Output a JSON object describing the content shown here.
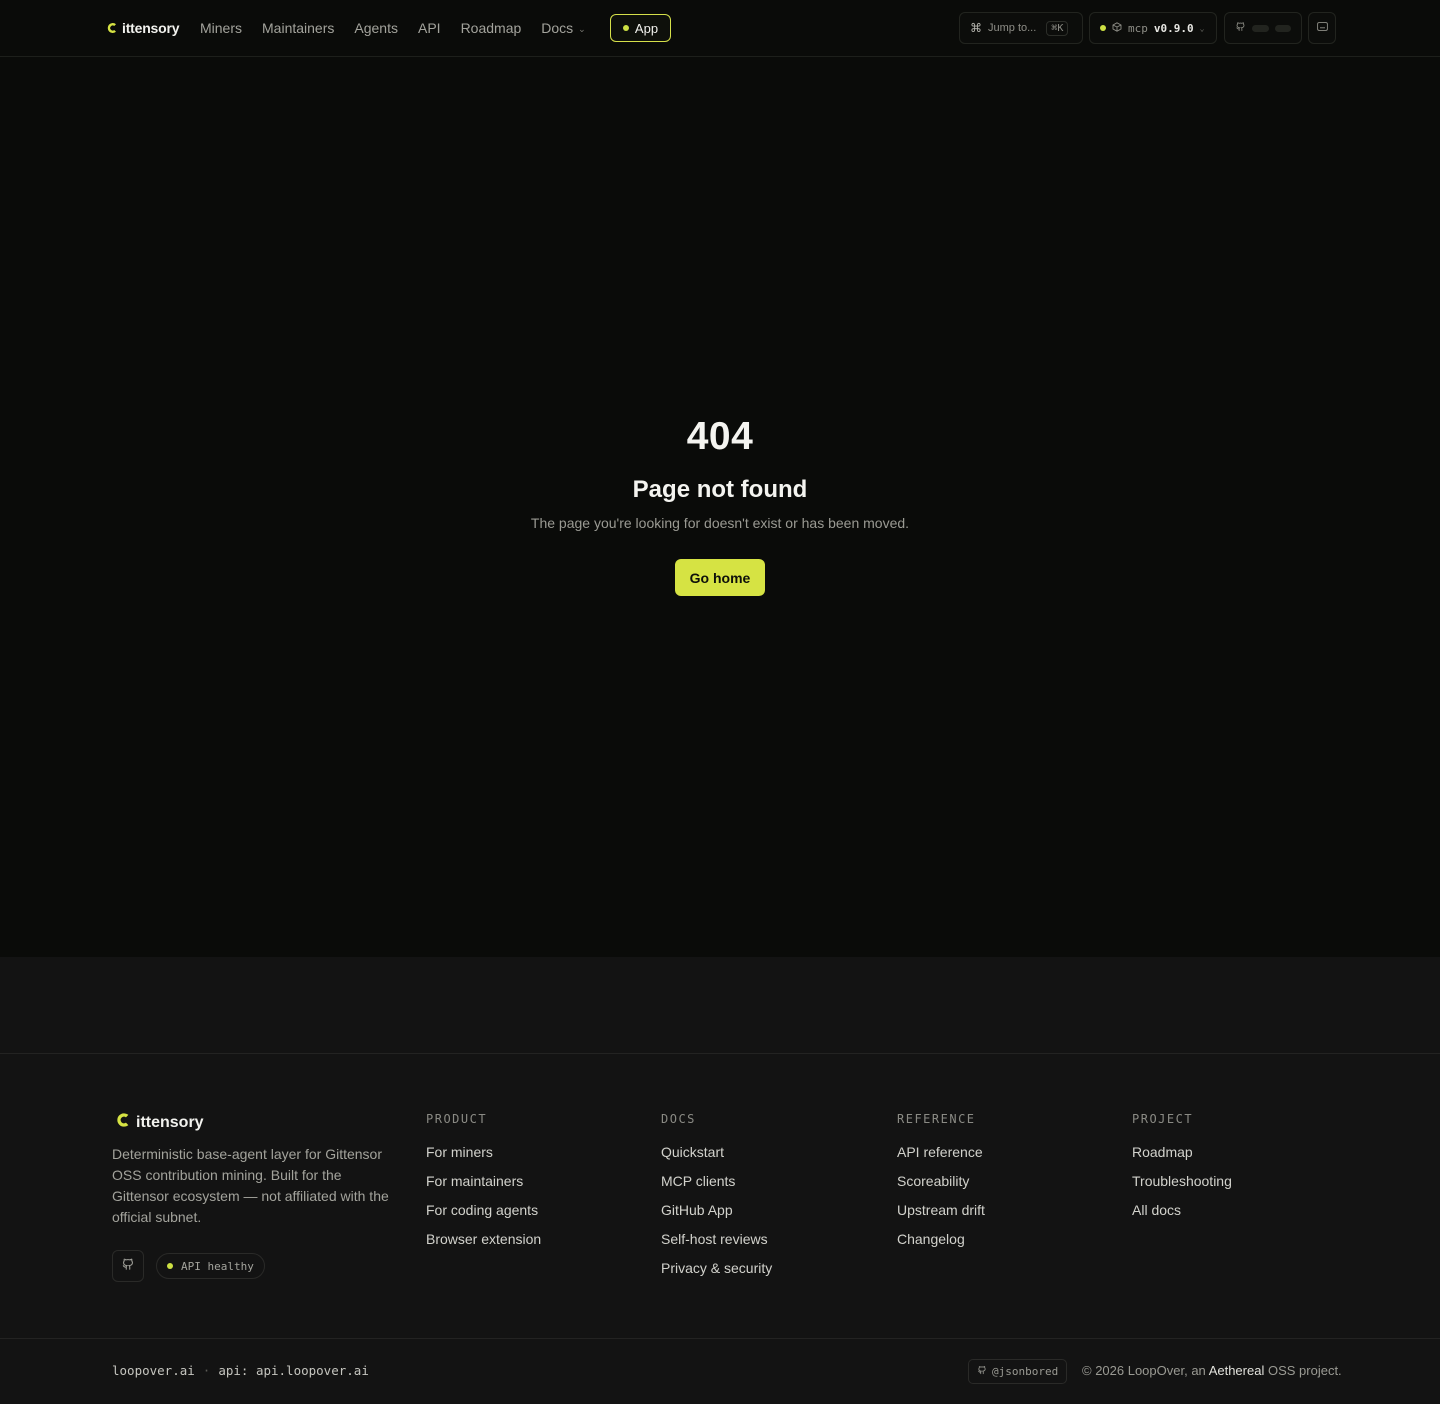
{
  "header": {
    "brand": "ittensory",
    "nav": [
      {
        "label": "Miners"
      },
      {
        "label": "Maintainers"
      },
      {
        "label": "Agents"
      },
      {
        "label": "API"
      },
      {
        "label": "Roadmap"
      },
      {
        "label": "Docs"
      }
    ],
    "app_label": "App",
    "jump_label": "Jump to...",
    "jump_shortcut": "⌘K",
    "mcp_label": "mcp",
    "mcp_version": "v0.9.0"
  },
  "main": {
    "code": "404",
    "title": "Page not found",
    "subtitle": "The page you're looking for doesn't exist or has been moved.",
    "home_button": "Go home"
  },
  "footer": {
    "brand": "ittensory",
    "description": "Deterministic base-agent layer for Gittensor OSS contribution mining. Built for the Gittensor ecosystem — not affiliated with the official subnet.",
    "api_status": "API healthy",
    "columns": [
      {
        "title": "PRODUCT",
        "links": [
          "For miners",
          "For maintainers",
          "For coding agents",
          "Browser extension"
        ]
      },
      {
        "title": "DOCS",
        "links": [
          "Quickstart",
          "MCP clients",
          "GitHub App",
          "Self-host reviews",
          "Privacy & security"
        ]
      },
      {
        "title": "REFERENCE",
        "links": [
          "API reference",
          "Scoreability",
          "Upstream drift",
          "Changelog"
        ]
      },
      {
        "title": "PROJECT",
        "links": [
          "Roadmap",
          "Troubleshooting",
          "All docs"
        ]
      }
    ],
    "domain": "loopover.ai",
    "separator": "·",
    "api_label": "api: api.loopover.ai",
    "handle": "@jsonbored",
    "copyright_prefix": "© 2026 LoopOver, an",
    "copyright_org": "Aethereal",
    "copyright_suffix": "OSS project."
  },
  "colors": {
    "accent": "#d6e343",
    "background": "#0a0b09",
    "footer_bg": "#131313"
  },
  "icons": {
    "brand": "brand-logo-icon",
    "jump": "command-icon",
    "mcp": "package-icon",
    "github": "github-icon",
    "settings": "keyboard-icon"
  }
}
